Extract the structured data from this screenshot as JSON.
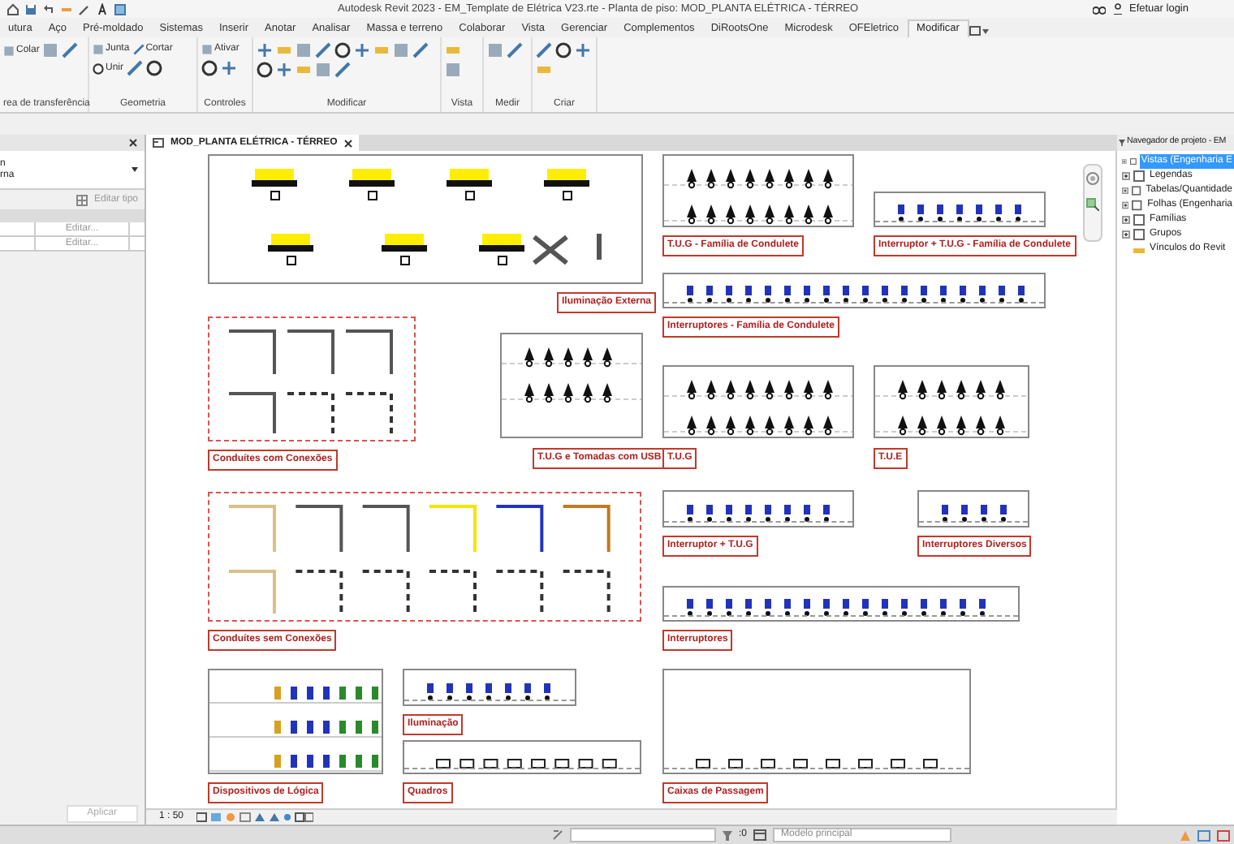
{
  "window": {
    "title": "Autodesk Revit 2023 - EM_Template de Elétrica V23.rte - Planta de piso: MOD_PLANTA ELÉTRICA - TÉRREO"
  },
  "account": {
    "label": "Efetuar login"
  },
  "ribbon_tabs": [
    {
      "label": "utura",
      "selected": false
    },
    {
      "label": "Aço",
      "selected": false
    },
    {
      "label": "Pré-moldado",
      "selected": false
    },
    {
      "label": "Sistemas",
      "selected": false
    },
    {
      "label": "Inserir",
      "selected": false
    },
    {
      "label": "Anotar",
      "selected": false
    },
    {
      "label": "Analisar",
      "selected": false
    },
    {
      "label": "Massa e terreno",
      "selected": false
    },
    {
      "label": "Colaborar",
      "selected": false
    },
    {
      "label": "Vista",
      "selected": false
    },
    {
      "label": "Gerenciar",
      "selected": false
    },
    {
      "label": "Complementos",
      "selected": false
    },
    {
      "label": "DiRootsOne",
      "selected": false
    },
    {
      "label": "Microdesk",
      "selected": false
    },
    {
      "label": "OFEletrico",
      "selected": false
    },
    {
      "label": "Modificar",
      "selected": true
    }
  ],
  "ribbon_panels": [
    {
      "title": "rea de transferência",
      "buttons": [
        "Colar"
      ]
    },
    {
      "title": "Geometria",
      "buttons": [
        "Junta",
        "Cortar",
        "Unir"
      ]
    },
    {
      "title": "Controles",
      "buttons": [
        "Ativar"
      ]
    },
    {
      "title": "Modificar"
    },
    {
      "title": "Vista"
    },
    {
      "title": "Medir"
    },
    {
      "title": "Criar"
    }
  ],
  "properties": {
    "type_lines": [
      "n",
      "rna"
    ],
    "edit_type": "Editar tipo",
    "rows": [
      "Editar...",
      "Editar..."
    ],
    "apply": "Aplicar"
  },
  "view_tab": {
    "title": "MOD_PLANTA ELÉTRICA - TÉRREO"
  },
  "canvas": {
    "groups": [
      {
        "label": "Iluminação Externa",
        "kind": "lights"
      },
      {
        "label": "T.U.G - Família de Condulete",
        "kind": "outlets"
      },
      {
        "label": "Interruptor + T.U.G - Família de Condulete",
        "kind": "switches"
      },
      {
        "label": "Interruptores - Família de Condulete",
        "kind": "switches"
      },
      {
        "label": "Conduítes com Conexões",
        "kind": "conduits"
      },
      {
        "label": "T.U.G e Tomadas com USB",
        "kind": "outlets"
      },
      {
        "label": "T.U.G",
        "kind": "outlets"
      },
      {
        "label": "T.U.E",
        "kind": "outlets"
      },
      {
        "label": "Conduítes sem Conexões",
        "kind": "conduits"
      },
      {
        "label": "Interruptor + T.U.G",
        "kind": "switches"
      },
      {
        "label": "Interruptores Diversos",
        "kind": "switches"
      },
      {
        "label": "Interruptores",
        "kind": "switches"
      },
      {
        "label": "Dispositivos de Lógica",
        "kind": "data"
      },
      {
        "label": "Iluminação",
        "kind": "switches"
      },
      {
        "label": "Quadros",
        "kind": "panels"
      },
      {
        "label": "Caixas de Passagem",
        "kind": "panels"
      }
    ],
    "scale": "1 : 50"
  },
  "project_browser": {
    "title": "Navegador de projeto - EM",
    "items": [
      {
        "label": "Vistas (Engenharia E",
        "selected": true
      },
      {
        "label": "Legendas",
        "selected": false
      },
      {
        "label": "Tabelas/Quantidade",
        "selected": false
      },
      {
        "label": "Folhas (Engenharia",
        "selected": false
      },
      {
        "label": "Famílias",
        "selected": false
      },
      {
        "label": "Grupos",
        "selected": false
      },
      {
        "label": "Vínculos do Revit",
        "selected": false
      }
    ]
  },
  "status_bar": {
    "value": ":0",
    "model": "Modelo principal"
  }
}
